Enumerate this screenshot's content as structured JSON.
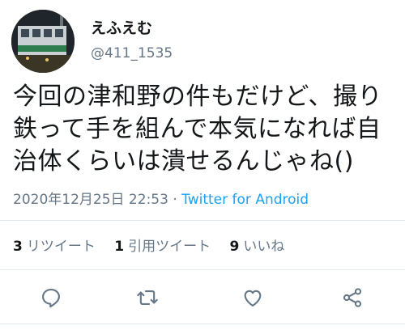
{
  "user": {
    "display_name": "えふえむ",
    "handle": "@411_1535"
  },
  "tweet": {
    "text": "今回の津和野の件もだけど、撮り\n鉄って手を組んで本気になれば自\n治体くらいは潰せるんじゃね()",
    "timestamp": "2020年12月25日 22:53",
    "separator": " · ",
    "source": "Twitter for Android"
  },
  "stats": {
    "retweets_count": "3",
    "retweets_label": "リツイート",
    "quotes_count": "1",
    "quotes_label": "引用ツイート",
    "likes_count": "9",
    "likes_label": "いいね"
  },
  "colors": {
    "text": "#14171a",
    "muted": "#657786",
    "link": "#1da1f2",
    "divider": "#e1e8ed"
  },
  "icons": [
    "reply-icon",
    "retweet-icon",
    "like-icon",
    "share-icon"
  ]
}
